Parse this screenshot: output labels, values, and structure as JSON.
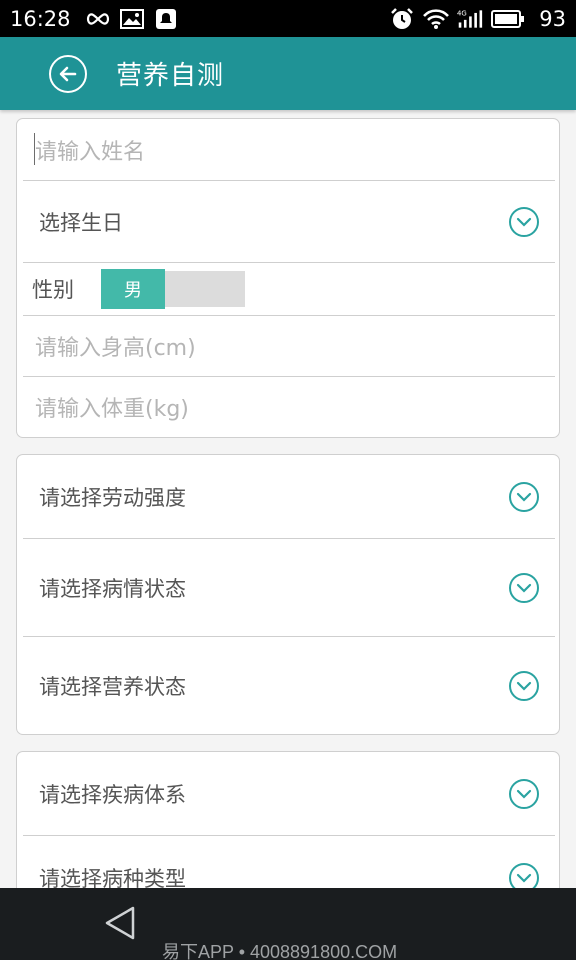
{
  "status_bar": {
    "time": "16:28",
    "left_icons": [
      "infinity-icon",
      "image-icon",
      "notification-icon"
    ],
    "right_icons": [
      "alarm-icon",
      "wifi-icon",
      "signal-4g-icon",
      "battery-icon"
    ],
    "battery": "93"
  },
  "header": {
    "title": "营养自测",
    "back_icon": "back-arrow-circle-icon",
    "color": "#1f9396"
  },
  "basic_info": {
    "name_placeholder": "请输入姓名",
    "birthday_label": "选择生日",
    "gender_label": "性别",
    "gender_selected": "男",
    "height_placeholder": "请输入身高(cm)",
    "weight_placeholder": "请输入体重(kg)"
  },
  "status_card": {
    "labor_intensity": "请选择劳动强度",
    "illness_state": "请选择病情状态",
    "nutrition_state": "请选择营养状态"
  },
  "disease_card": {
    "disease_system": "请选择疾病体系",
    "disease_type": "请选择病种类型"
  },
  "watermark": "易下APP • 4008891800.COM",
  "accent": "#2aa3a1"
}
